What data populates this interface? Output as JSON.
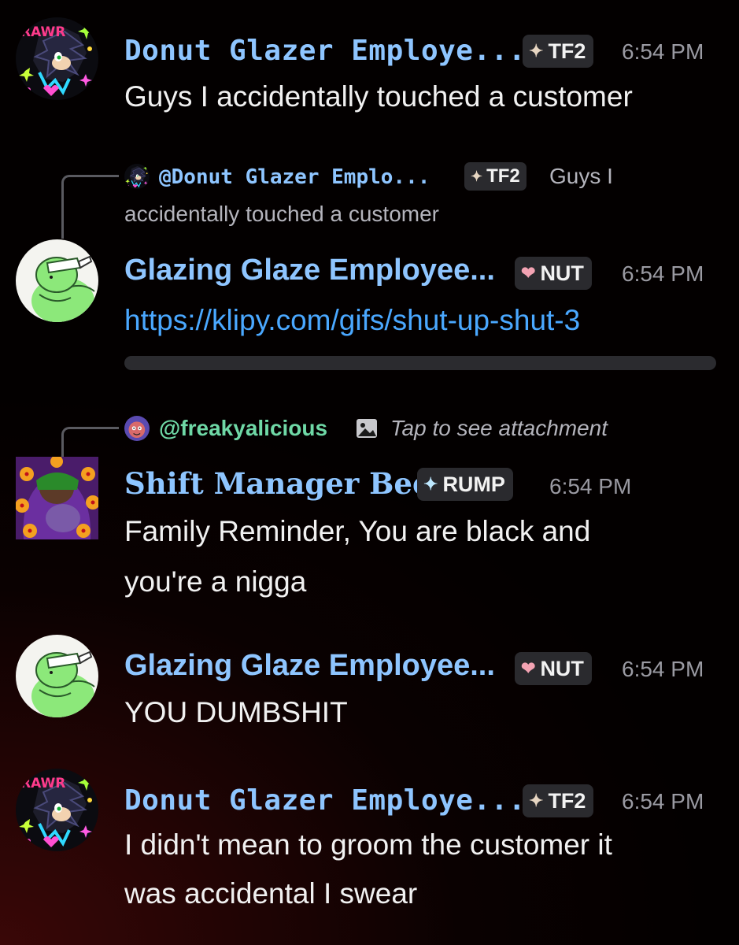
{
  "messages": [
    {
      "author": "Donut Glazer Employe...",
      "tag": "TF2",
      "time": "6:54 PM",
      "lines": [
        "Guys I accidentally touched a customer"
      ]
    },
    {
      "reply": {
        "mention": "@Donut Glazer Emplo...",
        "tag": "TF2",
        "preview_1": "Guys I",
        "preview_2": "accidentally touched a customer"
      },
      "author": "Glazing Glaze Employee...",
      "tag": "NUT",
      "time": "6:54 PM",
      "link": "https://klipy.com/gifs/shut-up-shut-3"
    },
    {
      "reply": {
        "mention": "@freakyalicious",
        "preview": "Tap to see attachment"
      },
      "author": "Shift Manager Beef",
      "tag": "RUMP",
      "time": "6:54 PM",
      "lines": [
        "Family Reminder, You are black and",
        "you're a nigga"
      ]
    },
    {
      "author": "Glazing Glaze Employee...",
      "tag": "NUT",
      "time": "6:54 PM",
      "lines": [
        "YOU DUMBSHIT"
      ]
    },
    {
      "author": "Donut Glazer Employe...",
      "tag": "TF2",
      "time": "6:54 PM",
      "lines": [
        "I didn't mean to groom the customer it",
        "was accidental I swear"
      ]
    }
  ],
  "avatar_texts": {
    "rawr": "RAWR"
  },
  "icons": {
    "tag_diamond": "diamond-sparkle-icon",
    "tag_heart": "heart-icon",
    "attachment": "image-icon"
  },
  "colors": {
    "username": "#8ec5ff",
    "link": "#4aa8ff",
    "mention_green": "#6fd8a6",
    "timestamp": "#9a9aa2",
    "tag_bg": "#2a2a2e"
  }
}
